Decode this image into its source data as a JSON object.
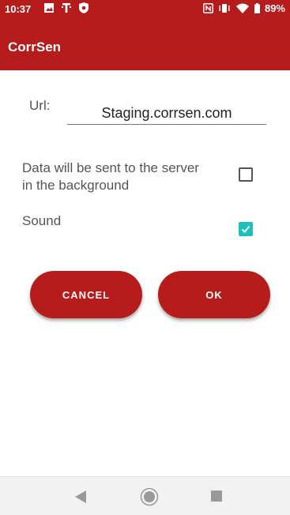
{
  "status_bar": {
    "time": "10:37",
    "battery": "89%",
    "icons_left": [
      "image-icon",
      "tmobile-icon",
      "shield-icon"
    ],
    "icons_right": [
      "nfc-icon",
      "vibrate-icon",
      "wifi-icon",
      "battery-icon"
    ]
  },
  "app_bar": {
    "title": "CorrSen",
    "color": "#b71c1c"
  },
  "form": {
    "url_label": "Url:",
    "url_value": "Staging.corrsen.com",
    "background_label": "Data will be sent to the server in the background",
    "background_checked": false,
    "sound_label": "Sound",
    "sound_checked": true,
    "check_color": "#1cc1bf"
  },
  "buttons": {
    "cancel": "CANCEL",
    "ok": "OK"
  },
  "nav_bar": {
    "icons": [
      "back-icon",
      "home-icon",
      "recents-icon"
    ]
  }
}
